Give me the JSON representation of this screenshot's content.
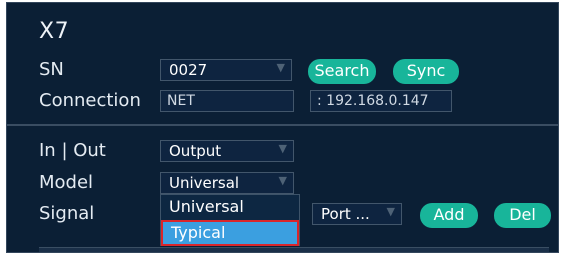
{
  "device": {
    "title": "X7"
  },
  "labels": {
    "sn": "SN",
    "connection": "Connection",
    "in_out": "In | Out",
    "model": "Model",
    "signal": "Signal"
  },
  "fields": {
    "sn_value": "0027",
    "connection_type": "NET",
    "connection_address": ": 192.168.0.147",
    "in_out_value": "Output",
    "model_value": "Universal",
    "port_value": "Port ..."
  },
  "buttons": {
    "search": "Search",
    "sync": "Sync",
    "add": "Add",
    "del": "Del"
  },
  "model_dropdown": {
    "options": [
      "Universal",
      "Typical"
    ],
    "highlighted": "Typical"
  },
  "colors": {
    "panel_bg": "#0b1f35",
    "accent_button": "#18b59a",
    "highlight": "#3b9fe0",
    "annotation_border": "#d9262b"
  }
}
